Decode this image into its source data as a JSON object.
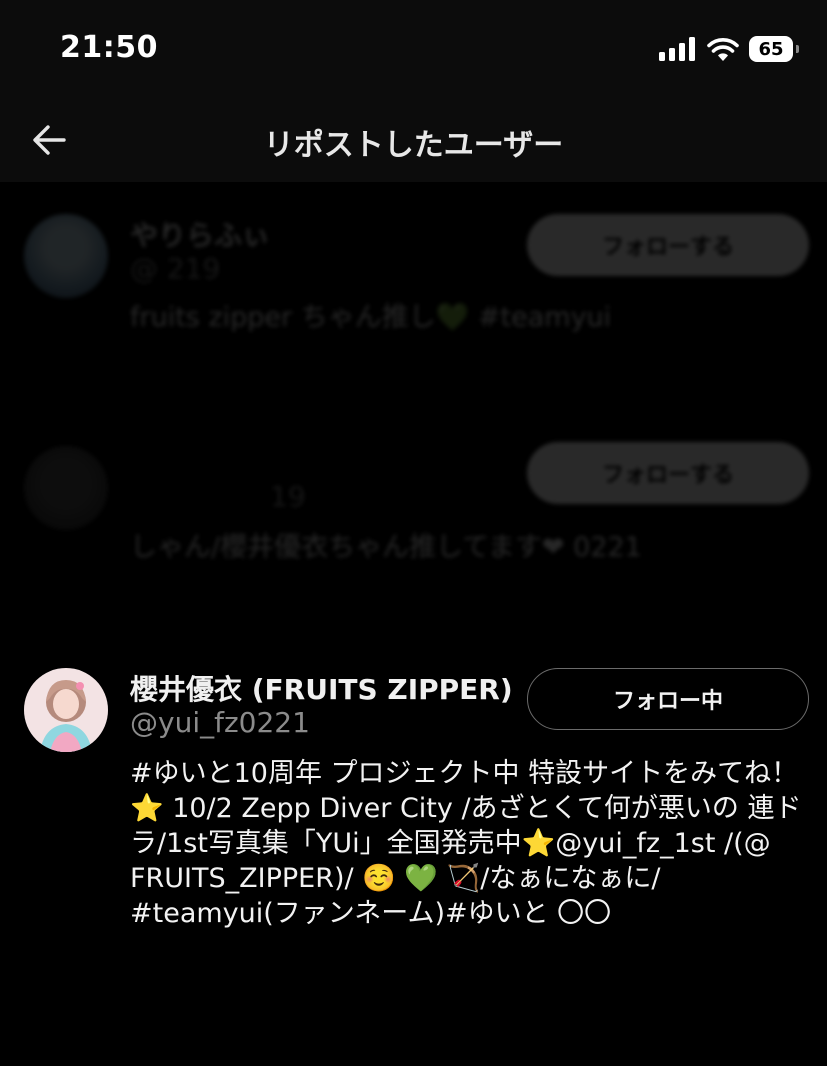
{
  "status_bar": {
    "time": "21:50",
    "battery": "65",
    "signal_icon": "cellular-signal-icon",
    "wifi_icon": "wifi-icon"
  },
  "header": {
    "back_icon": "arrow-left-icon",
    "title": "リポストしたユーザー"
  },
  "users": [
    {
      "name": "やりらふぃ",
      "handle": "@ 219",
      "bio": "fruits zipper ちゃん推し💚 #teamyui",
      "follow_label": "フォローする",
      "follow_state": "not-following"
    },
    {
      "name": "",
      "handle": "19",
      "bio": "しゃん/櫻井優衣ちゃん推してます❤ 0221",
      "follow_label": "フォローする",
      "follow_state": "not-following"
    },
    {
      "name": "櫻井優衣 (FRUITS ZIPPER)",
      "handle": "@yui_fz0221",
      "bio": "#ゆいと10周年 プロジェクト中 特設サイトをみてね！⭐️ 10/2 Zepp Diver City /あざとくて何が悪いの 連ドラ/1st写真集「YUi」全国発売中⭐️@yui_fz_1st /(@ FRUITS_ZIPPER)/ ☺️ 💚 🏹/なぁになぁに/ #teamyui(ファンネーム)#ゆいと 〇〇",
      "follow_label": "フォロー中",
      "follow_state": "following"
    }
  ],
  "colors": {
    "background": "#000000",
    "header_background": "#0c0c0c",
    "text_primary": "#f2f2f2",
    "text_secondary": "#8b8b8b"
  }
}
